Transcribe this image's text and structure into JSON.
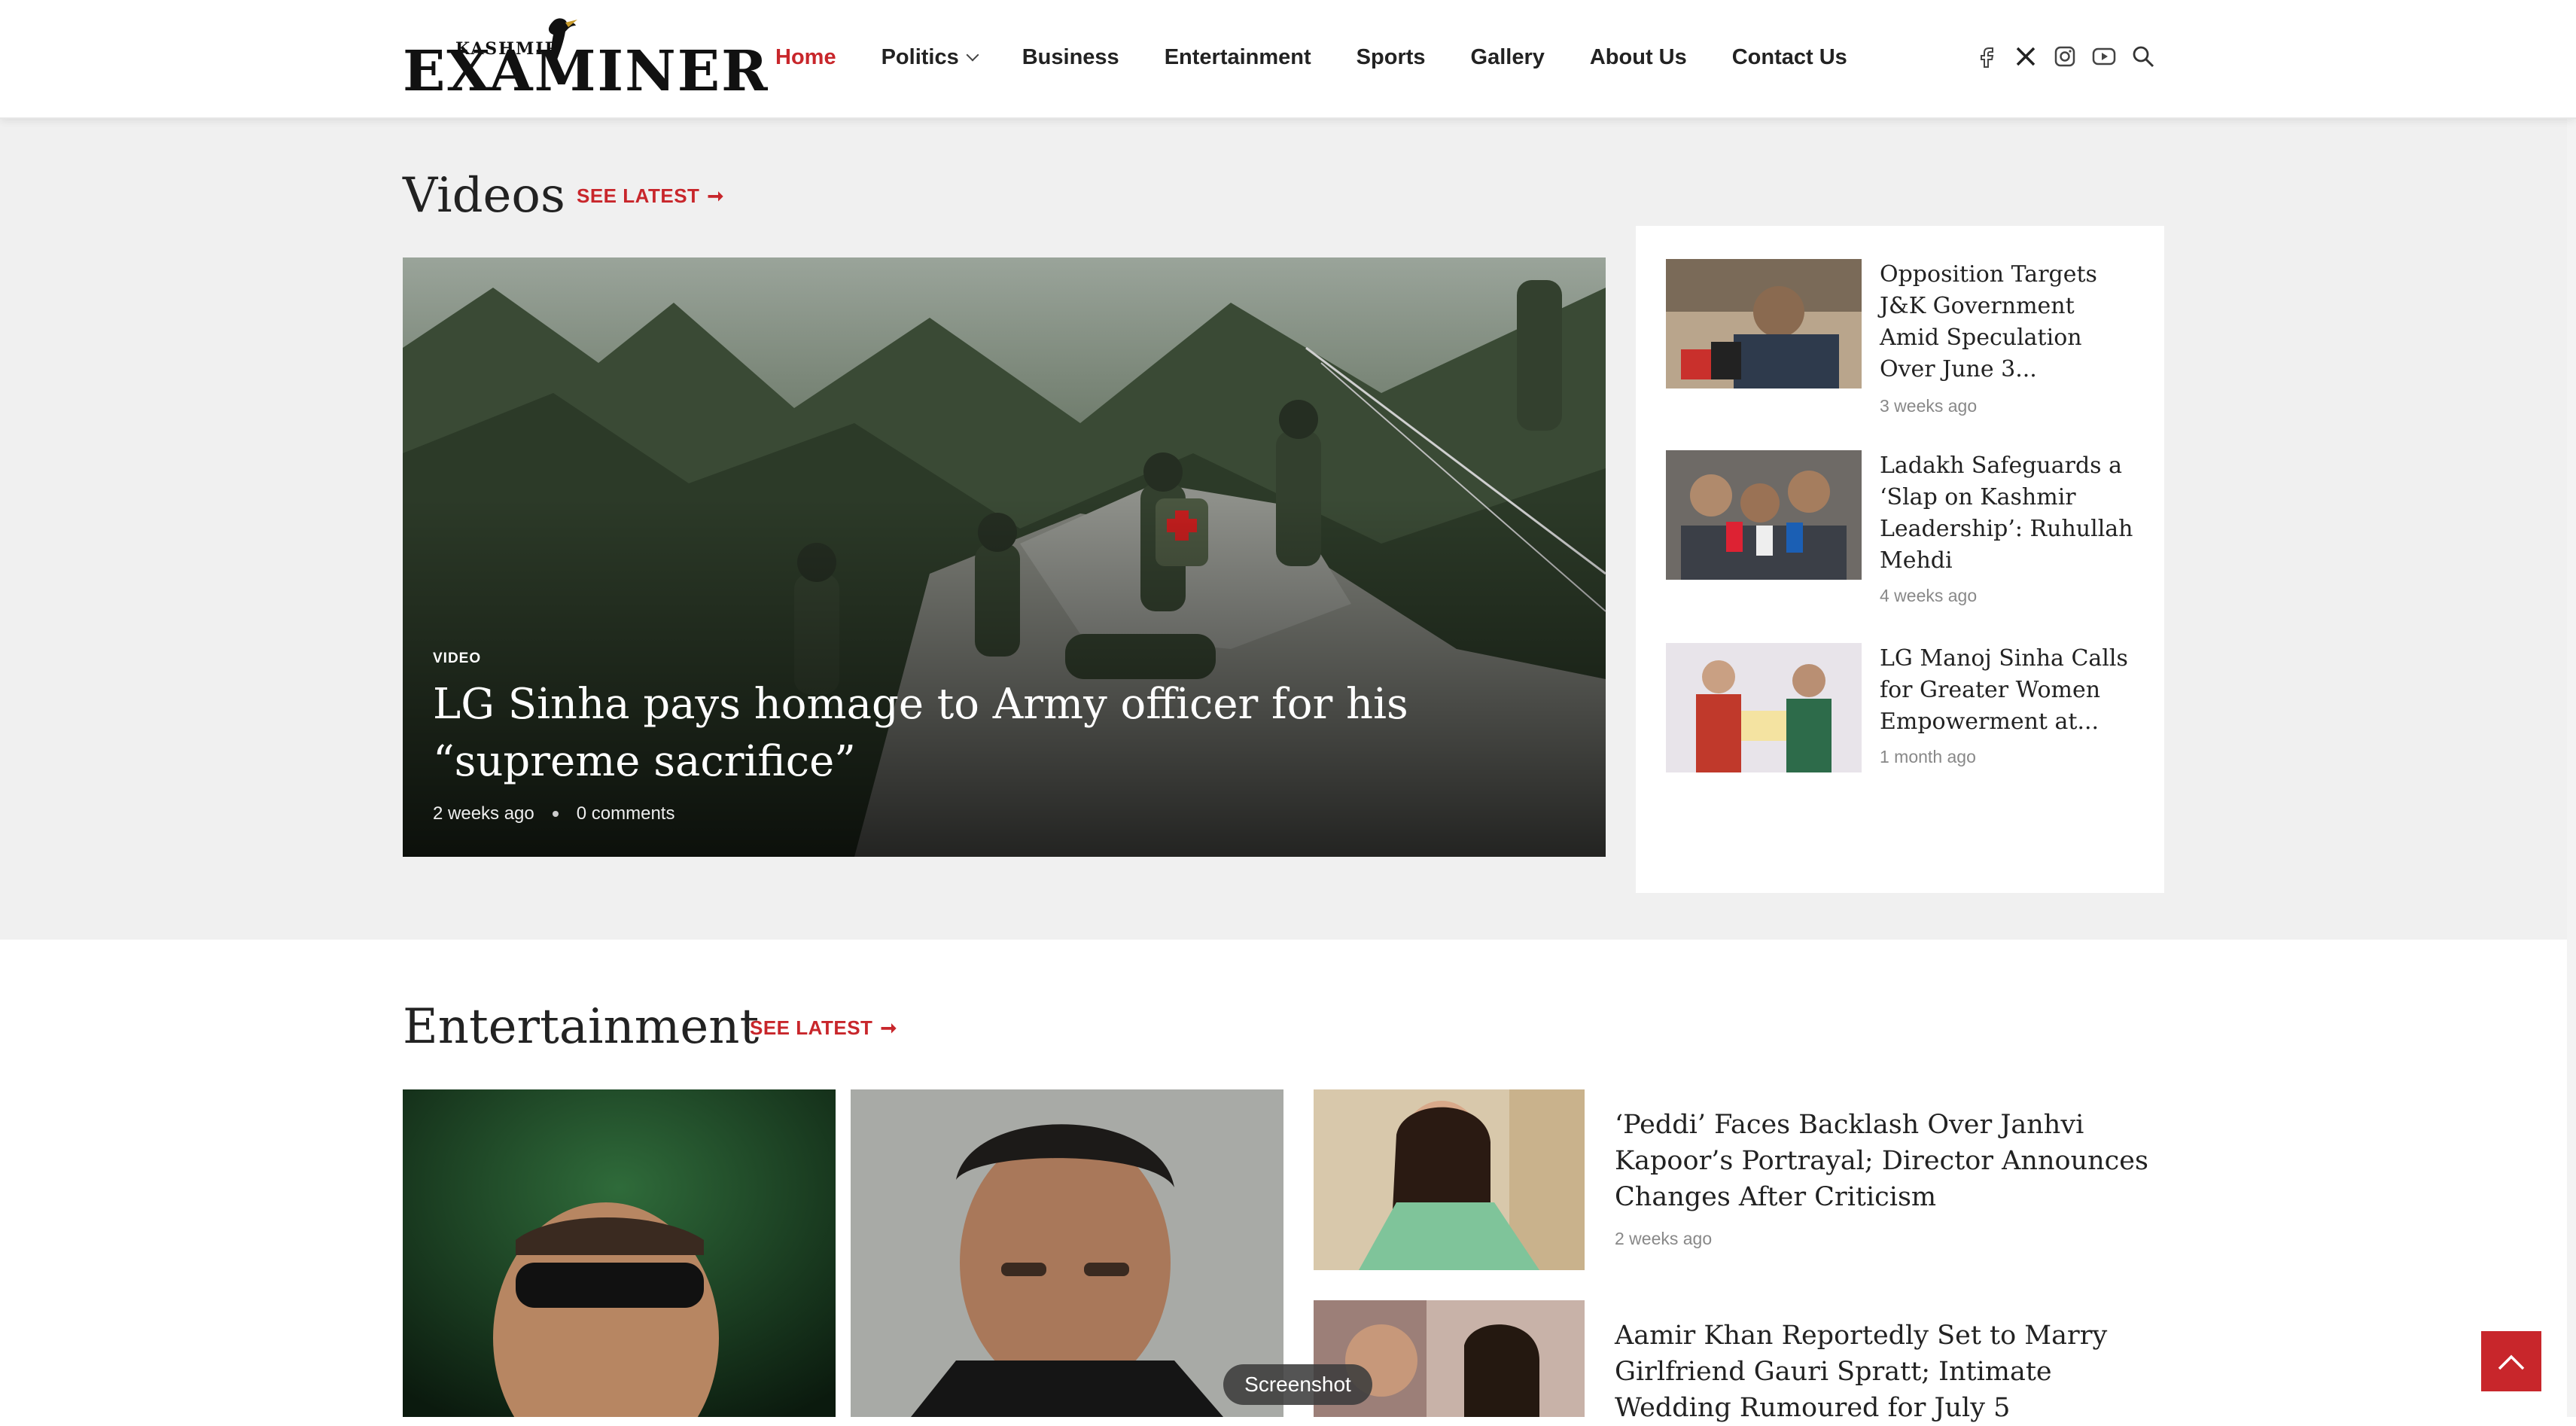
{
  "site": {
    "logo_main": "EXAMINER",
    "logo_sub": "KASHMIR"
  },
  "nav": {
    "items": [
      {
        "label": "Home",
        "active": true
      },
      {
        "label": "Politics",
        "dropdown": true
      },
      {
        "label": "Business"
      },
      {
        "label": "Entertainment"
      },
      {
        "label": "Sports"
      },
      {
        "label": "Gallery"
      },
      {
        "label": "About Us"
      },
      {
        "label": "Contact Us"
      }
    ],
    "social_icons": [
      "facebook-icon",
      "x-twitter-icon",
      "instagram-icon",
      "youtube-icon",
      "search-icon"
    ]
  },
  "videos": {
    "title": "Videos",
    "see_latest": "SEE LATEST",
    "hero": {
      "category": "VIDEO",
      "title": "LG Sinha pays homage to Army officer for his “supreme sacrifice”",
      "date": "2 weeks ago",
      "comments": "0 comments"
    },
    "side_items": [
      {
        "title": "Opposition Targets J&K Government Amid Speculation Over June 3...",
        "date": "3 weeks ago"
      },
      {
        "title": "Ladakh Safeguards a ‘Slap on Kashmir Leadership’: Ruhullah Mehdi",
        "date": "4 weeks ago"
      },
      {
        "title": "LG Manoj Sinha Calls for Greater Women Empowerment at...",
        "date": "1 month ago"
      }
    ]
  },
  "entertainment": {
    "title": "Entertainment",
    "see_latest": "SEE LATEST",
    "list_items": [
      {
        "title": "‘Peddi’ Faces Backlash Over Janhvi Kapoor’s Portrayal; Director Announces Changes After Criticism",
        "date": "2 weeks ago"
      },
      {
        "title": "Aamir Khan Reportedly Set to Marry Girlfriend Gauri Spratt; Intimate Wedding Rumoured for July 5",
        "date": ""
      }
    ]
  },
  "overlay": {
    "tooltip": "Screenshot"
  },
  "colors": {
    "accent": "#c8262b",
    "band_bg": "#f0f0f0",
    "text": "#222222",
    "muted": "#888888"
  }
}
